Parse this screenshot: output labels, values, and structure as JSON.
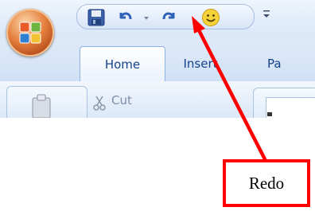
{
  "ribbon": {
    "tabs": [
      {
        "label": "Home",
        "selected": true
      },
      {
        "label": "Insert"
      },
      {
        "label": "Pa"
      }
    ],
    "clipboard": {
      "cut_label": "Cut"
    }
  },
  "quick_access_toolbar": {
    "buttons": [
      "save-icon",
      "undo-icon",
      "undo-dropdown",
      "redo-icon",
      "smiley-icon"
    ],
    "customize": "customize-qat-icon"
  },
  "callout": {
    "label": "Redo",
    "color": "#ff0000"
  }
}
